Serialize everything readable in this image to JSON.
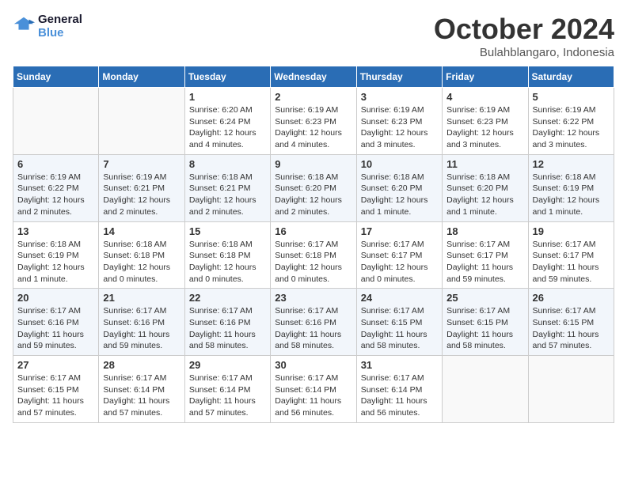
{
  "header": {
    "logo_line1": "General",
    "logo_line2": "Blue",
    "month": "October 2024",
    "location": "Bulahblangaro, Indonesia"
  },
  "weekdays": [
    "Sunday",
    "Monday",
    "Tuesday",
    "Wednesday",
    "Thursday",
    "Friday",
    "Saturday"
  ],
  "weeks": [
    [
      {
        "day": "",
        "info": ""
      },
      {
        "day": "",
        "info": ""
      },
      {
        "day": "1",
        "info": "Sunrise: 6:20 AM\nSunset: 6:24 PM\nDaylight: 12 hours and 4 minutes."
      },
      {
        "day": "2",
        "info": "Sunrise: 6:19 AM\nSunset: 6:23 PM\nDaylight: 12 hours and 4 minutes."
      },
      {
        "day": "3",
        "info": "Sunrise: 6:19 AM\nSunset: 6:23 PM\nDaylight: 12 hours and 3 minutes."
      },
      {
        "day": "4",
        "info": "Sunrise: 6:19 AM\nSunset: 6:23 PM\nDaylight: 12 hours and 3 minutes."
      },
      {
        "day": "5",
        "info": "Sunrise: 6:19 AM\nSunset: 6:22 PM\nDaylight: 12 hours and 3 minutes."
      }
    ],
    [
      {
        "day": "6",
        "info": "Sunrise: 6:19 AM\nSunset: 6:22 PM\nDaylight: 12 hours and 2 minutes."
      },
      {
        "day": "7",
        "info": "Sunrise: 6:19 AM\nSunset: 6:21 PM\nDaylight: 12 hours and 2 minutes."
      },
      {
        "day": "8",
        "info": "Sunrise: 6:18 AM\nSunset: 6:21 PM\nDaylight: 12 hours and 2 minutes."
      },
      {
        "day": "9",
        "info": "Sunrise: 6:18 AM\nSunset: 6:20 PM\nDaylight: 12 hours and 2 minutes."
      },
      {
        "day": "10",
        "info": "Sunrise: 6:18 AM\nSunset: 6:20 PM\nDaylight: 12 hours and 1 minute."
      },
      {
        "day": "11",
        "info": "Sunrise: 6:18 AM\nSunset: 6:20 PM\nDaylight: 12 hours and 1 minute."
      },
      {
        "day": "12",
        "info": "Sunrise: 6:18 AM\nSunset: 6:19 PM\nDaylight: 12 hours and 1 minute."
      }
    ],
    [
      {
        "day": "13",
        "info": "Sunrise: 6:18 AM\nSunset: 6:19 PM\nDaylight: 12 hours and 1 minute."
      },
      {
        "day": "14",
        "info": "Sunrise: 6:18 AM\nSunset: 6:18 PM\nDaylight: 12 hours and 0 minutes."
      },
      {
        "day": "15",
        "info": "Sunrise: 6:18 AM\nSunset: 6:18 PM\nDaylight: 12 hours and 0 minutes."
      },
      {
        "day": "16",
        "info": "Sunrise: 6:17 AM\nSunset: 6:18 PM\nDaylight: 12 hours and 0 minutes."
      },
      {
        "day": "17",
        "info": "Sunrise: 6:17 AM\nSunset: 6:17 PM\nDaylight: 12 hours and 0 minutes."
      },
      {
        "day": "18",
        "info": "Sunrise: 6:17 AM\nSunset: 6:17 PM\nDaylight: 11 hours and 59 minutes."
      },
      {
        "day": "19",
        "info": "Sunrise: 6:17 AM\nSunset: 6:17 PM\nDaylight: 11 hours and 59 minutes."
      }
    ],
    [
      {
        "day": "20",
        "info": "Sunrise: 6:17 AM\nSunset: 6:16 PM\nDaylight: 11 hours and 59 minutes."
      },
      {
        "day": "21",
        "info": "Sunrise: 6:17 AM\nSunset: 6:16 PM\nDaylight: 11 hours and 59 minutes."
      },
      {
        "day": "22",
        "info": "Sunrise: 6:17 AM\nSunset: 6:16 PM\nDaylight: 11 hours and 58 minutes."
      },
      {
        "day": "23",
        "info": "Sunrise: 6:17 AM\nSunset: 6:16 PM\nDaylight: 11 hours and 58 minutes."
      },
      {
        "day": "24",
        "info": "Sunrise: 6:17 AM\nSunset: 6:15 PM\nDaylight: 11 hours and 58 minutes."
      },
      {
        "day": "25",
        "info": "Sunrise: 6:17 AM\nSunset: 6:15 PM\nDaylight: 11 hours and 58 minutes."
      },
      {
        "day": "26",
        "info": "Sunrise: 6:17 AM\nSunset: 6:15 PM\nDaylight: 11 hours and 57 minutes."
      }
    ],
    [
      {
        "day": "27",
        "info": "Sunrise: 6:17 AM\nSunset: 6:15 PM\nDaylight: 11 hours and 57 minutes."
      },
      {
        "day": "28",
        "info": "Sunrise: 6:17 AM\nSunset: 6:14 PM\nDaylight: 11 hours and 57 minutes."
      },
      {
        "day": "29",
        "info": "Sunrise: 6:17 AM\nSunset: 6:14 PM\nDaylight: 11 hours and 57 minutes."
      },
      {
        "day": "30",
        "info": "Sunrise: 6:17 AM\nSunset: 6:14 PM\nDaylight: 11 hours and 56 minutes."
      },
      {
        "day": "31",
        "info": "Sunrise: 6:17 AM\nSunset: 6:14 PM\nDaylight: 11 hours and 56 minutes."
      },
      {
        "day": "",
        "info": ""
      },
      {
        "day": "",
        "info": ""
      }
    ]
  ]
}
